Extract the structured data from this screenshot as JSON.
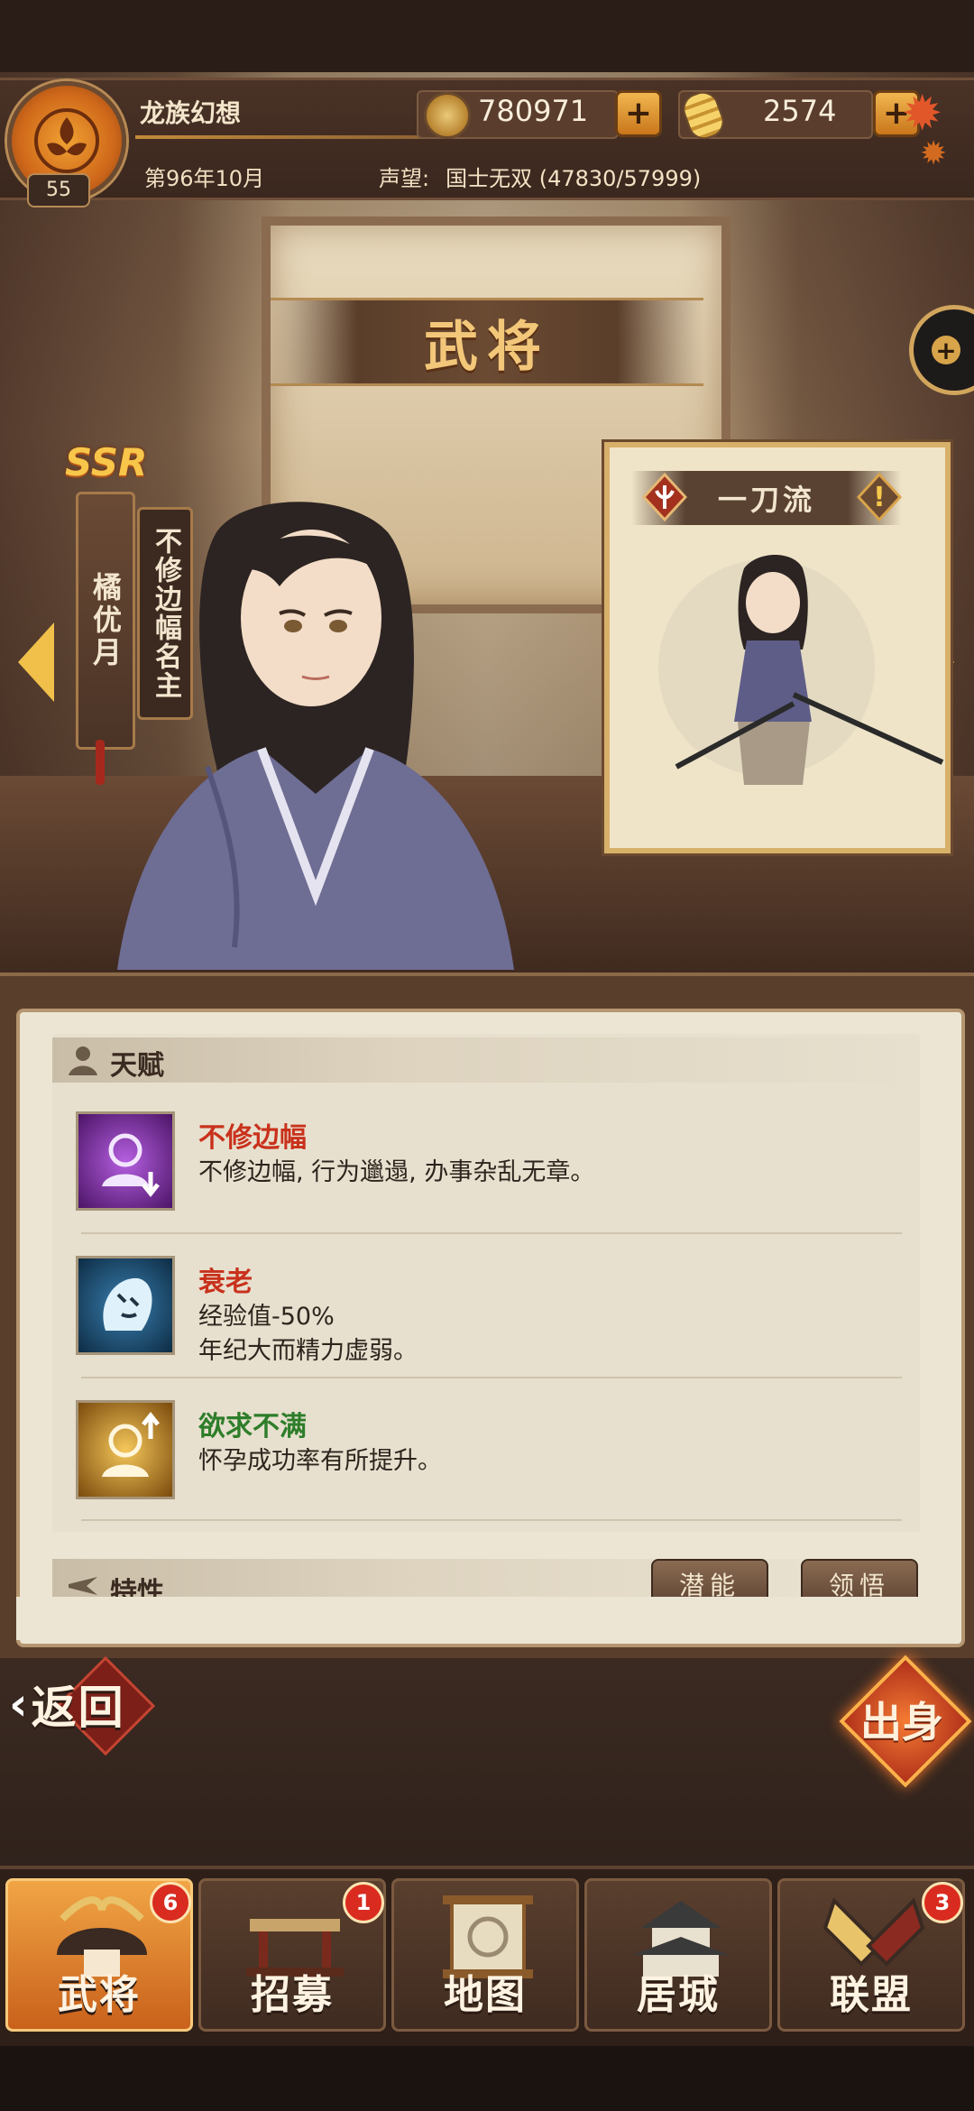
{
  "header": {
    "game_name": "龙族幻想",
    "level": "55",
    "date": "第96年10月",
    "prestige_label": "声望:",
    "prestige_value": "国士无双 (47830/57999)",
    "coins": "780971",
    "ingots": "2574",
    "plus": "+"
  },
  "screen_title": "武将",
  "character": {
    "rarity": "SSR",
    "name": "橘优月",
    "title": "不修边幅名主",
    "school": "一刀流",
    "warning": "!"
  },
  "talent_section": {
    "title": "天赋",
    "traits": [
      {
        "name": "不修边幅",
        "name_color": "#c9311c",
        "desc_lines": [
          "不修边幅, 行为邋遢, 办事杂乱无章。"
        ],
        "icon": "purple-person-down-icon"
      },
      {
        "name": "衰老",
        "name_color": "#c9311c",
        "desc_lines": [
          "经验值-50%",
          "年纪大而精力虚弱。"
        ],
        "icon": "blue-aging-face-icon"
      },
      {
        "name": "欲求不满",
        "name_color": "#2e7d2a",
        "desc_lines": [
          "怀孕成功率有所提升。"
        ],
        "icon": "gold-person-up-icon"
      }
    ]
  },
  "trait_section": {
    "title": "特性",
    "btn_potential": "潜能",
    "btn_comprehend": "领悟"
  },
  "buttons": {
    "back": "返回",
    "origin": "出身"
  },
  "nav": [
    {
      "label": "武将",
      "badge": "6",
      "active": true
    },
    {
      "label": "招募",
      "badge": "1",
      "active": false
    },
    {
      "label": "地图",
      "badge": "",
      "active": false
    },
    {
      "label": "居城",
      "badge": "",
      "active": false
    },
    {
      "label": "联盟",
      "badge": "3",
      "active": false
    }
  ],
  "colors": {
    "accent_gold": "#f0c04a",
    "panel_bg": "#ece5d4",
    "badge_red": "#d92b1f"
  }
}
